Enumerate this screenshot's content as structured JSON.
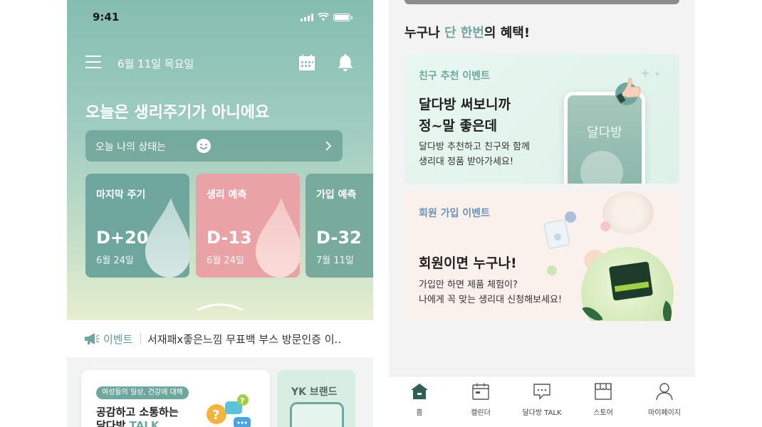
{
  "left": {
    "status": {
      "time": "9:41"
    },
    "header": {
      "date": "6월 11일 목요일"
    },
    "headline": "오늘은 생리주기가 아니에요",
    "mood": {
      "label": "오늘 나의 상태는"
    },
    "cards": [
      {
        "title": "마지막 주기",
        "dday": "D+20",
        "date": "6월 24일"
      },
      {
        "title": "생리 예측",
        "dday": "D-13",
        "date": "6월 24일"
      },
      {
        "title": "가입 예측",
        "dday": "D-32",
        "date": "7월 11일"
      }
    ],
    "notice": {
      "tag": "이벤트",
      "text": "서재패x좋은느낌 무표백 부스 방문인증 이.."
    },
    "community": {
      "pill": "여성들의 일상, 건강에 대해",
      "title_line1": "공감하고 소통하는",
      "title_line2_prefix": "달다방 ",
      "title_line2_accent": "TALK",
      "brand_label": "YK 브랜드"
    }
  },
  "right": {
    "benefit": {
      "prefix": "누구나 ",
      "accent": "단 한번",
      "suffix": "의 혜택!"
    },
    "events": [
      {
        "tag": "친구 추천 이벤트",
        "title_line1": "달다방 써보니까",
        "title_line2": "정~말 좋은데",
        "desc_line1": "달다방 추천하고 친구와 함께",
        "desc_line2": "생리대 정품 받아가세요!",
        "mock_brand": "달다방"
      },
      {
        "tag": "회원 가입 이벤트",
        "title_line1": "회원이면 누구나!",
        "desc_line1": "가입만 하면 제품 체험이?",
        "desc_line2": "나에게 꼭 맞는 생리대 신청해보세요!"
      }
    ],
    "tabbar": [
      {
        "label": "홈",
        "icon": "home-icon"
      },
      {
        "label": "캘린더",
        "icon": "calendar-icon"
      },
      {
        "label": "달다방 TALK",
        "icon": "chat-icon"
      },
      {
        "label": "스토어",
        "icon": "store-icon"
      },
      {
        "label": "마이페이지",
        "icon": "person-icon"
      }
    ]
  },
  "colors": {
    "accent": "#6fa79f",
    "pink": "#e9a3a6",
    "hero_top": "#86bdb1",
    "hero_bottom": "#e6efcf"
  }
}
